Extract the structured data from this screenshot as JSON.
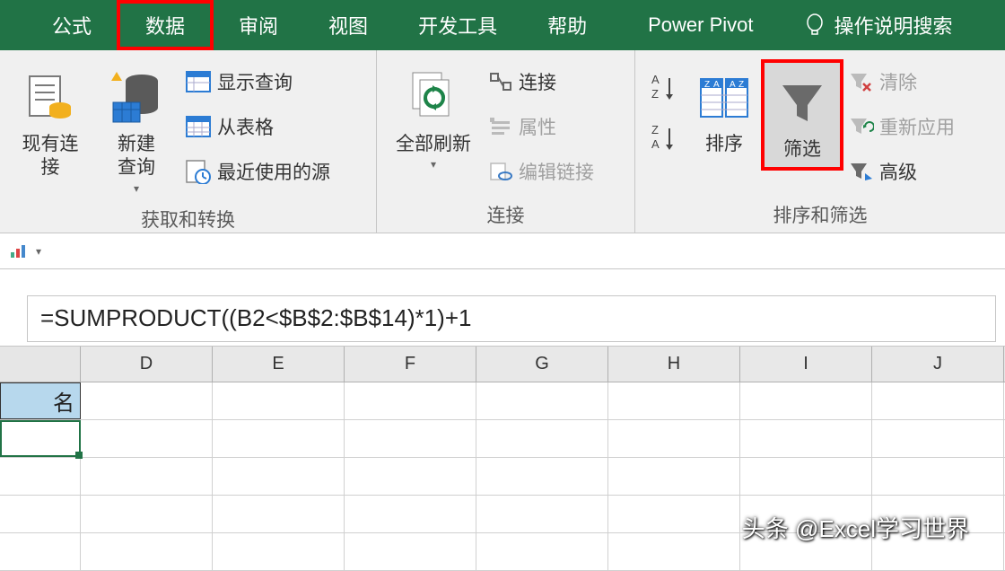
{
  "tabs": {
    "formula": "公式",
    "data": "数据",
    "review": "审阅",
    "view": "视图",
    "devtools": "开发工具",
    "help": "帮助",
    "powerpivot": "Power Pivot",
    "tellme": "操作说明搜索"
  },
  "ribbon": {
    "group1": {
      "existing_conn": "现有连接",
      "new_query": "新建\n查询",
      "show_queries": "显示查询",
      "from_table": "从表格",
      "recent_sources": "最近使用的源",
      "label": "获取和转换"
    },
    "group2": {
      "refresh_all": "全部刷新",
      "connections": "连接",
      "properties": "属性",
      "edit_links": "编辑链接",
      "label": "连接"
    },
    "group3": {
      "sort": "排序",
      "filter": "筛选",
      "clear": "清除",
      "reapply": "重新应用",
      "advanced": "高级",
      "label": "排序和筛选"
    }
  },
  "formula_bar": {
    "value": "=SUMPRODUCT((B2<$B$2:$B$14)*1)+1"
  },
  "grid": {
    "partial_header": "名",
    "cols": [
      "D",
      "E",
      "F",
      "G",
      "H",
      "I",
      "J"
    ]
  },
  "watermark": "头条 @Excel学习世界"
}
